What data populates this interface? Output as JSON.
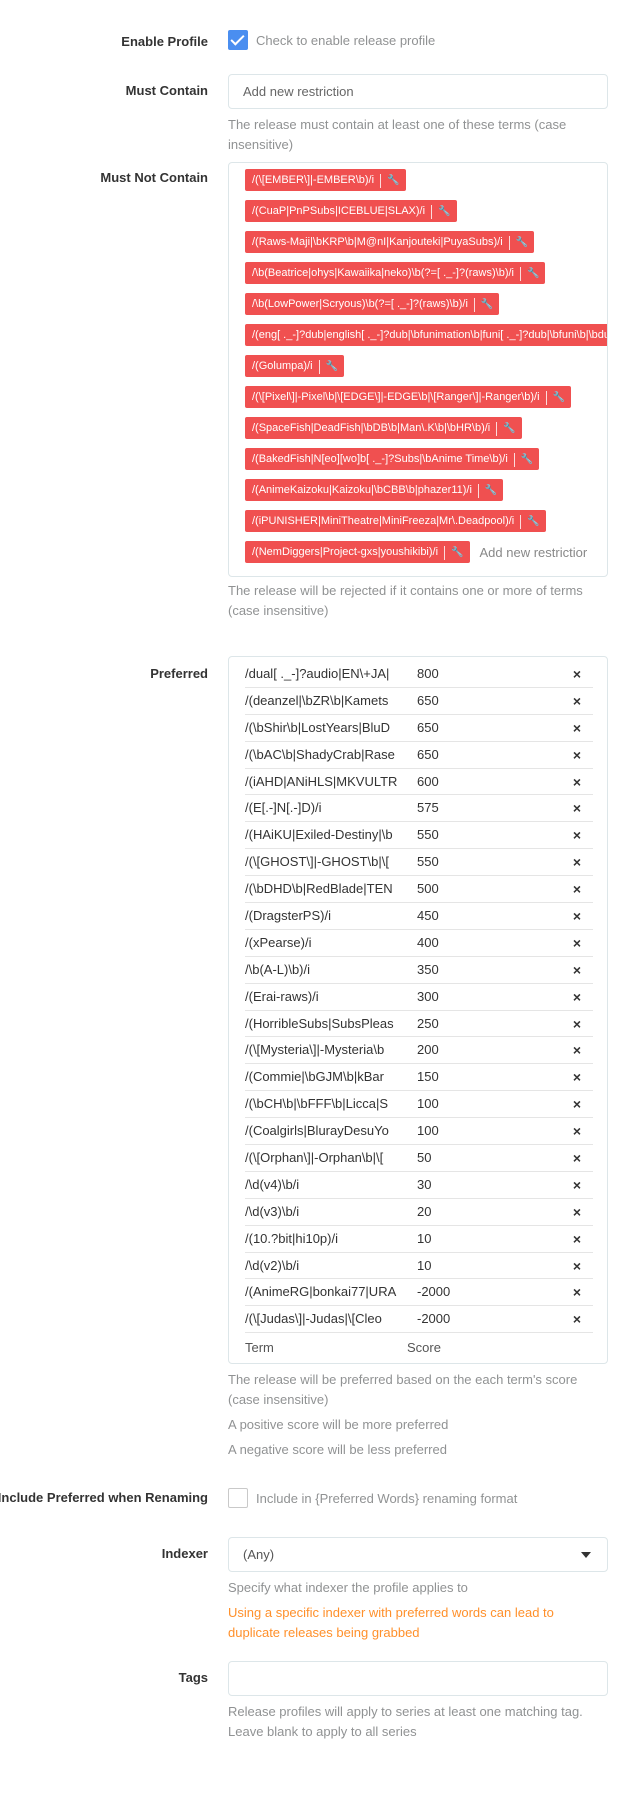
{
  "enable_profile": {
    "label": "Enable Profile",
    "checked": true,
    "text": "Check to enable release profile"
  },
  "must_contain": {
    "label": "Must Contain",
    "placeholder": "Add new restriction",
    "help": "The release must contain at least one of these terms (case insensitive)"
  },
  "must_not_contain": {
    "label": "Must Not Contain",
    "tags": [
      "/(\\[EMBER\\]|-EMBER\\b)/i",
      "/(CuaP|PnPSubs|ICEBLUE|SLAX)/i",
      "/(Raws-Maji|\\bKRP\\b|M@nI|Kanjouteki|PuyaSubs)/i",
      "/\\b(Beatrice|ohys|Kawaiika|neko)\\b(?=[ ._-]?(raws)\\b)/i",
      "/\\b(LowPower|Scryous)\\b(?=[ ._-]?(raws)\\b)/i",
      "/(eng[ ._-]?dub|english[ ._-]?dub|\\bfunimation\\b|funi[ ._-]?dub|\\bfuni\\b|\\bdub\\b|\\",
      "/(Golumpa)/i",
      "/(\\[Pixel\\]|-Pixel\\b|\\[EDGE\\]|-EDGE\\b|\\[Ranger\\]|-Ranger\\b)/i",
      "/(SpaceFish|DeadFish|\\bDB\\b|Man\\.K\\b|\\bHR\\b)/i",
      "/(BakedFish|N[eo][wo]b[ ._-]?Subs|\\bAnime Time\\b)/i",
      "/(AnimeKaizoku|Kaizoku|\\bCBB\\b|phazer11)/i",
      "/(iPUNISHER|MiniTheatre|MiniFreeza|Mr\\.Deadpool)/i",
      "/(NemDiggers|Project-gxs|youshikibi)/i"
    ],
    "edit_icon": "wrench-icon",
    "placeholder": "Add new restrictior",
    "help": "The release will be rejected if it contains one or more of terms (case insensitive)"
  },
  "preferred": {
    "label": "Preferred",
    "rows": [
      {
        "term": "/dual[ ._-]?audio|EN\\+JA|",
        "score": "800"
      },
      {
        "term": "/(deanzel|\\bZR\\b|Kamets",
        "score": "650"
      },
      {
        "term": "/(\\bShir\\b|LostYears|BluD",
        "score": "650"
      },
      {
        "term": "/(\\bAC\\b|ShadyCrab|Rase",
        "score": "650"
      },
      {
        "term": "/(iAHD|ANiHLS|MKVULTR",
        "score": "600"
      },
      {
        "term": "/(E[.-]N[.-]D)/i",
        "score": "575"
      },
      {
        "term": "/(HAiKU|Exiled-Destiny|\\b",
        "score": "550"
      },
      {
        "term": "/(\\[GHOST\\]|-GHOST\\b|\\[",
        "score": "550"
      },
      {
        "term": "/(\\bDHD\\b|RedBlade|TEN",
        "score": "500"
      },
      {
        "term": "/(DragsterPS)/i",
        "score": "450"
      },
      {
        "term": "/(xPearse)/i",
        "score": "400"
      },
      {
        "term": "/\\b(A-L)\\b)/i",
        "score": "350"
      },
      {
        "term": "/(Erai-raws)/i",
        "score": "300"
      },
      {
        "term": "/(HorribleSubs|SubsPleas",
        "score": "250"
      },
      {
        "term": "/(\\[Mysteria\\]|-Mysteria\\b",
        "score": "200"
      },
      {
        "term": "/(Commie|\\bGJM\\b|kBar",
        "score": "150"
      },
      {
        "term": "/(\\bCH\\b|\\bFFF\\b|Licca|S",
        "score": "100"
      },
      {
        "term": "/(Coalgirls|BlurayDesuYo",
        "score": "100"
      },
      {
        "term": "/(\\[Orphan\\]|-Orphan\\b|\\[",
        "score": "50"
      },
      {
        "term": "/\\d(v4)\\b/i",
        "score": "30"
      },
      {
        "term": "/\\d(v3)\\b/i",
        "score": "20"
      },
      {
        "term": "/(10.?bit|hi10p)/i",
        "score": "10"
      },
      {
        "term": "/\\d(v2)\\b/i",
        "score": "10"
      },
      {
        "term": "/(AnimeRG|bonkai77|URA",
        "score": "-2000"
      },
      {
        "term": "/(\\[Judas\\]|-Judas|\\[Cleo",
        "score": "-2000"
      }
    ],
    "remove_symbol": "×",
    "term_header": "Term",
    "score_header": "Score",
    "help1": "The release will be preferred based on the each term's score (case insensitive)",
    "help2": "A positive score will be more preferred",
    "help3": "A negative score will be less preferred"
  },
  "include_preferred": {
    "label": "Include Preferred when Renaming",
    "checked": false,
    "text": "Include in {Preferred Words} renaming format"
  },
  "indexer": {
    "label": "Indexer",
    "value": "(Any)",
    "help": "Specify what indexer the profile applies to",
    "warning": "Using a specific indexer with preferred words can lead to duplicate releases being grabbed"
  },
  "tags": {
    "label": "Tags",
    "help": "Release profiles will apply to series at least one matching tag. Leave blank to apply to all series"
  },
  "colors": {
    "checkbox": "#4a8ef0",
    "tag": "#f05050",
    "warning": "#ff902b",
    "help": "#909293"
  }
}
